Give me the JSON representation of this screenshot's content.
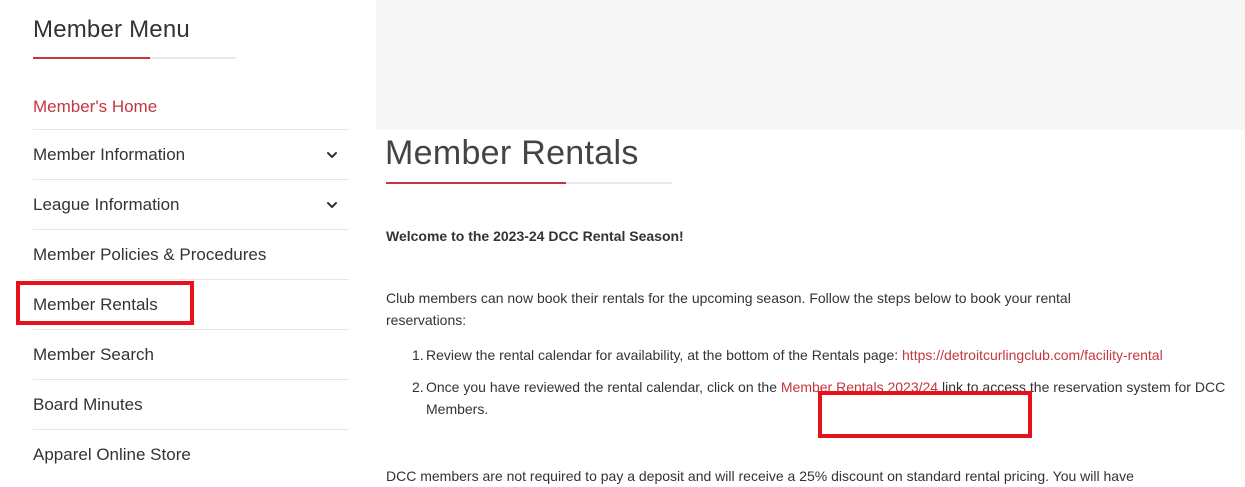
{
  "sidebar": {
    "title": "Member Menu",
    "items": [
      {
        "label": "Member's Home",
        "active": true,
        "has_dropdown": false
      },
      {
        "label": "Member Information",
        "active": false,
        "has_dropdown": true
      },
      {
        "label": "League Information",
        "active": false,
        "has_dropdown": true
      },
      {
        "label": "Member Policies & Procedures",
        "active": false,
        "has_dropdown": false
      },
      {
        "label": "Member Rentals",
        "active": false,
        "has_dropdown": false
      },
      {
        "label": "Member Search",
        "active": false,
        "has_dropdown": false
      },
      {
        "label": "Board Minutes",
        "active": false,
        "has_dropdown": false
      },
      {
        "label": "Apparel Online Store",
        "active": false,
        "has_dropdown": false
      }
    ]
  },
  "main": {
    "title": "Member Rentals",
    "welcome": "Welcome to the 2023-24 DCC Rental Season!",
    "intro": "Club members can now book their rentals for the upcoming season. Follow the steps below to book your rental reservations:",
    "steps": [
      {
        "number": "1.",
        "text_before": "Review the rental calendar for availability, at the bottom of the Rentals page: ",
        "link": "https://detroitcurlingclub.com/facility-rental",
        "text_after": ""
      },
      {
        "number": "2.",
        "text_before": "Once you have reviewed the rental calendar, click on the ",
        "link": "Member Rentals 2023/24",
        "text_after": " link to access the reservation system for DCC Members."
      }
    ],
    "note": "DCC members are not required to pay a deposit and will receive a 25% discount on standard rental pricing. You will have"
  },
  "icons": {
    "dropdown": "chevron-down-icon"
  },
  "colors": {
    "accent": "#c4373d",
    "highlight": "#e8101a",
    "text": "#333333",
    "banner": "#f7f7f7"
  }
}
